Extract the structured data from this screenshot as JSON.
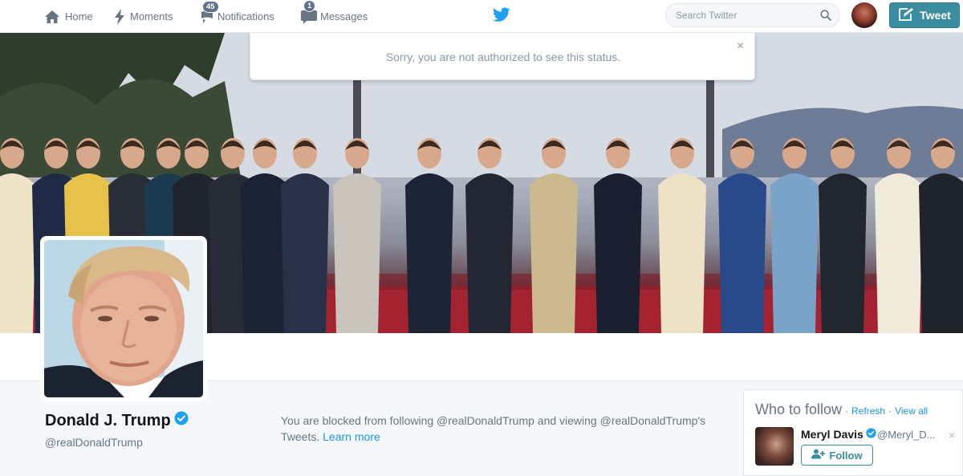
{
  "nav": {
    "home": "Home",
    "moments": "Moments",
    "notifications": "Notifications",
    "notifications_count": "45",
    "messages": "Messages",
    "messages_count": "1",
    "search_placeholder": "Search Twitter",
    "tweet_button": "Tweet"
  },
  "alert": {
    "message": "Sorry, you are not authorized to see this status.",
    "close": "×"
  },
  "profile": {
    "name": "Donald J. Trump",
    "handle": "@realDonaldTrump",
    "verified": true,
    "blocked_message": "You are blocked from following @realDonaldTrump and viewing @realDonaldTrump's Tweets.",
    "learn_more": "Learn more"
  },
  "who_to_follow": {
    "title": "Who to follow",
    "refresh": "Refresh",
    "view_all": "View all",
    "separator": "·",
    "suggestion": {
      "name": "Meryl Davis",
      "handle": "@Meryl_D...",
      "verified": true,
      "follow_label": "Follow",
      "dismiss": "×"
    }
  },
  "colors": {
    "accent": "#3b8da0",
    "link": "#1b95e0",
    "twitter_blue": "#1da1f2",
    "muted": "#657786"
  },
  "icons": [
    "home-icon",
    "moments-icon",
    "notifications-icon",
    "messages-icon",
    "twitter-bird-icon",
    "search-icon",
    "compose-icon",
    "verified-icon",
    "follow-user-icon",
    "close-icon"
  ]
}
